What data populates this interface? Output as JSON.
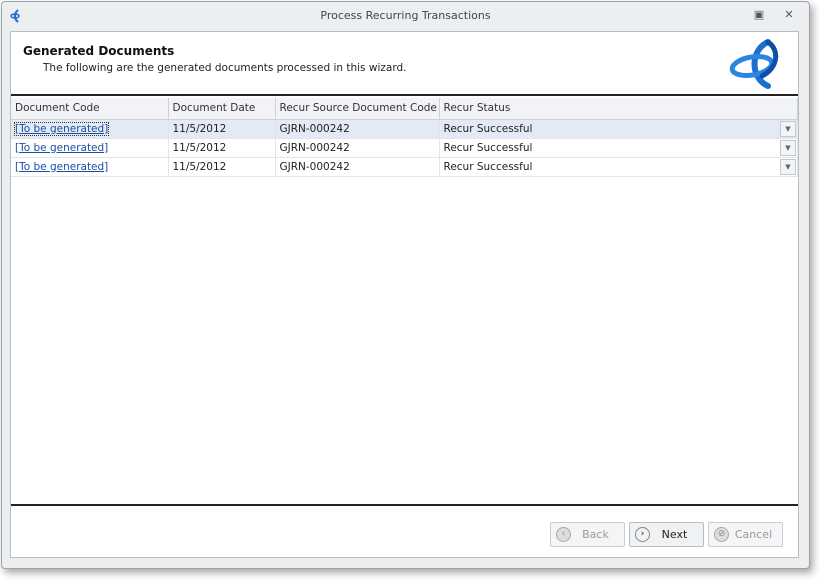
{
  "window": {
    "title": "Process Recurring Transactions"
  },
  "header": {
    "title": "Generated Documents",
    "subtitle": "The following are the generated documents processed in this wizard."
  },
  "grid": {
    "columns": [
      "Document Code",
      "Document Date",
      "Recur Source Document Code",
      "Recur Status"
    ],
    "rows": [
      {
        "code": "[To be generated]",
        "date": "11/5/2012",
        "source": "GJRN-000242",
        "status": "Recur Successful"
      },
      {
        "code": "[To be generated]",
        "date": "11/5/2012",
        "source": "GJRN-000242",
        "status": "Recur Successful"
      },
      {
        "code": "[To be generated]",
        "date": "11/5/2012",
        "source": "GJRN-000242",
        "status": "Recur Successful"
      }
    ]
  },
  "footer": {
    "back": "Back",
    "next": "Next",
    "cancel": "Cancel"
  },
  "colors": {
    "accent": "#1a6fd0",
    "link": "#1a4fa3",
    "selected_row": "#e3eaf3"
  }
}
